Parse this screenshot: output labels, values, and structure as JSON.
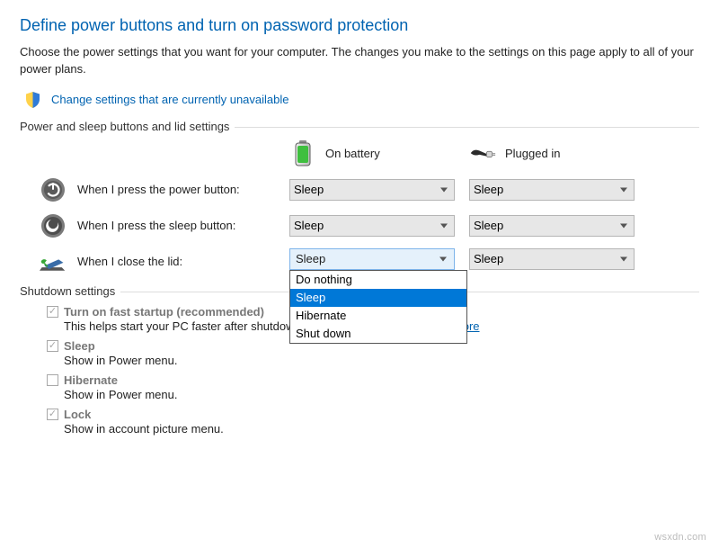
{
  "title": "Define power buttons and turn on password protection",
  "intro": "Choose the power settings that you want for your computer. The changes you make to the settings on this page apply to all of your power plans.",
  "admin_link": "Change settings that are currently unavailable",
  "group1_label": "Power and sleep buttons and lid settings",
  "columns": {
    "battery": "On battery",
    "plugged": "Plugged in"
  },
  "rows": {
    "power_button": {
      "label": "When I press the power button:",
      "battery": "Sleep",
      "plugged": "Sleep"
    },
    "sleep_button": {
      "label": "When I press the sleep button:",
      "battery": "Sleep",
      "plugged": "Sleep"
    },
    "lid_close": {
      "label": "When I close the lid:",
      "battery": "Sleep",
      "plugged": "Sleep"
    }
  },
  "lid_options": [
    "Do nothing",
    "Sleep",
    "Hibernate",
    "Shut down"
  ],
  "lid_selected_index": 1,
  "group2_label": "Shutdown settings",
  "shutdown": {
    "fast_startup": {
      "checked": true,
      "label": "Turn on fast startup (recommended)",
      "desc_pre": "This helps start your PC faster after shutdown. Restart isn't affected. ",
      "learn_more": "Learn More"
    },
    "sleep": {
      "checked": true,
      "label": "Sleep",
      "desc": "Show in Power menu."
    },
    "hibernate": {
      "checked": false,
      "label": "Hibernate",
      "desc": "Show in Power menu."
    },
    "lock": {
      "checked": true,
      "label": "Lock",
      "desc": "Show in account picture menu."
    }
  },
  "watermark": "wsxdn.com"
}
